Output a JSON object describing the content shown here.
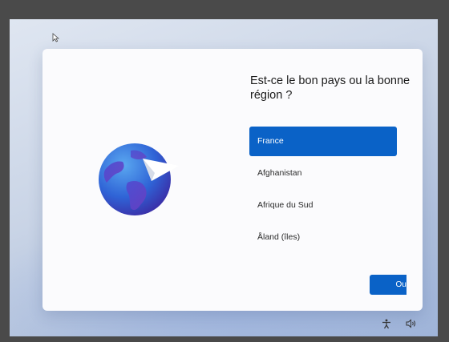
{
  "dialog": {
    "title": "Est-ce le bon pays ou la bonne région ?",
    "regions": [
      "France",
      "Afghanistan",
      "Afrique du Sud",
      "Åland (îles)"
    ],
    "selected": "France",
    "confirm_label": "Oui"
  },
  "icons": {
    "cursor": "mouse-pointer-icon",
    "illustration": "globe-paper-plane-icon",
    "tray": [
      "accessibility-icon",
      "volume-icon"
    ]
  },
  "colors": {
    "accent": "#0a62c7",
    "card": "#fbfbfd",
    "frame": "#4a4a4a"
  }
}
